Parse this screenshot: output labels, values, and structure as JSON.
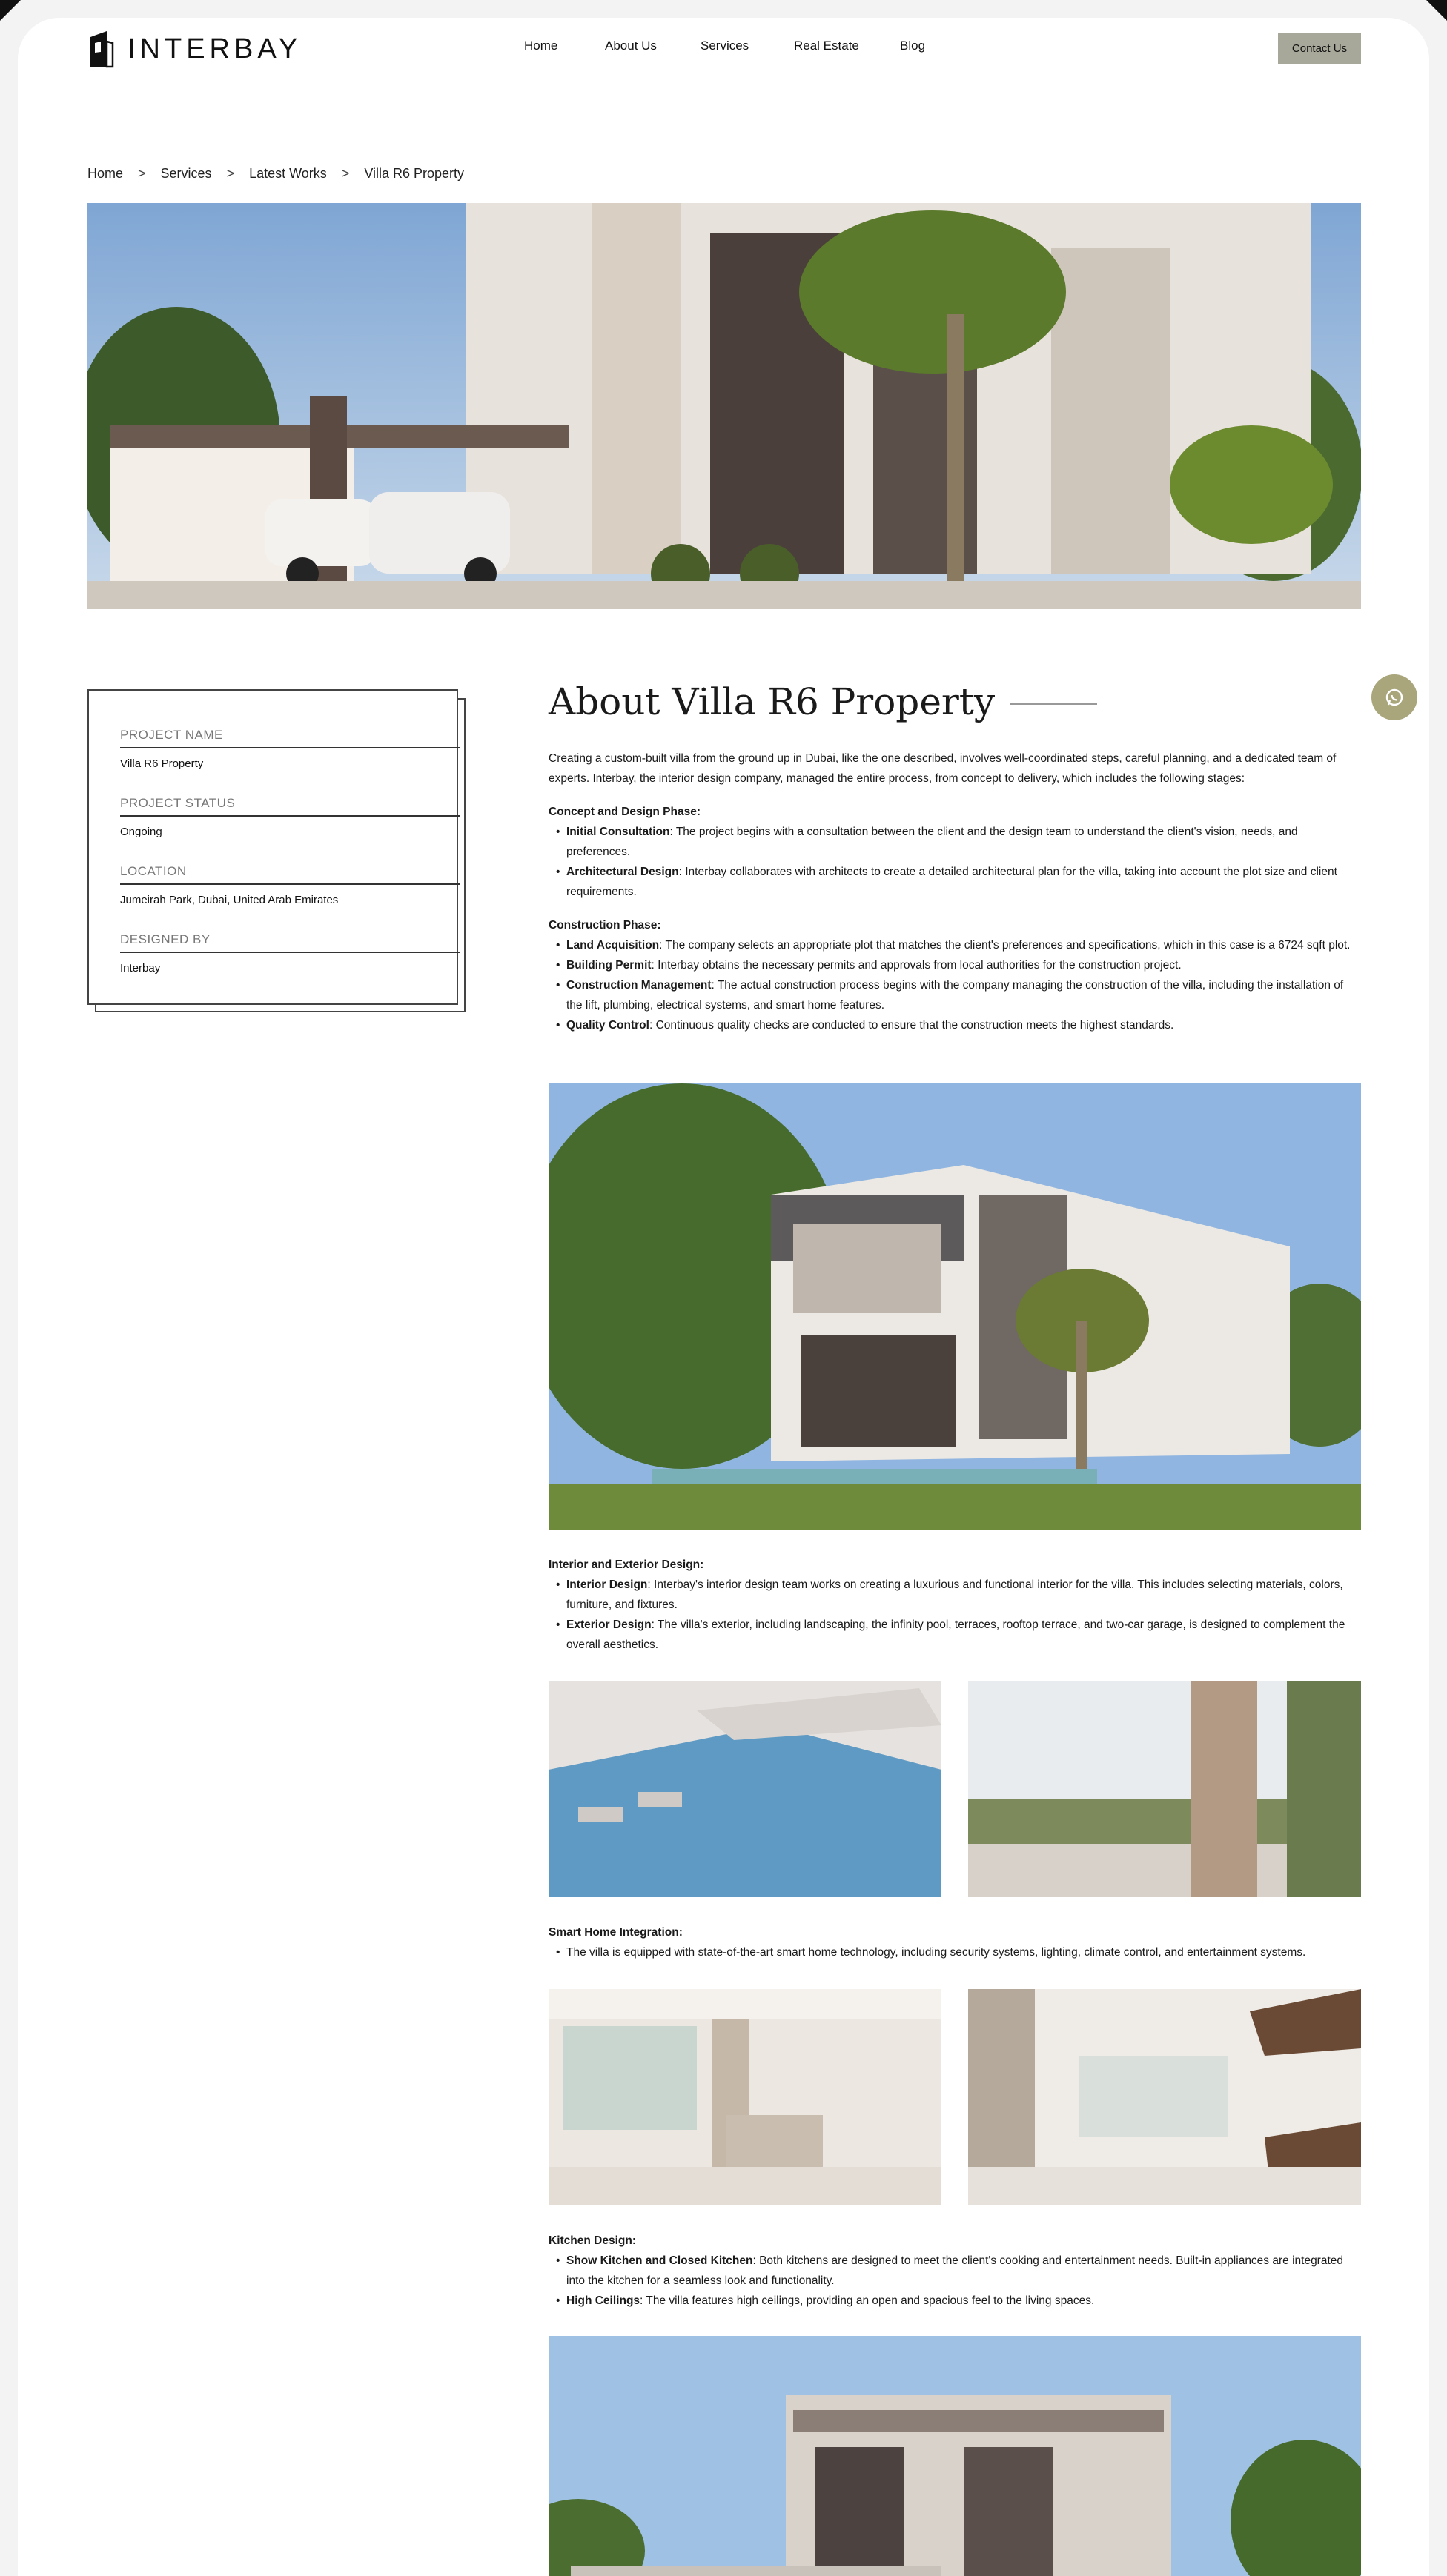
{
  "brand": {
    "name": "INTERBAY"
  },
  "nav": {
    "items": [
      "Home",
      "About Us",
      "Services",
      "Real Estate",
      "Blog"
    ],
    "contact": "Contact Us"
  },
  "breadcrumb": [
    "Home",
    "Services",
    "Latest Works",
    "Villa R6 Property"
  ],
  "breadcrumb_sep": ">",
  "project": {
    "name_label": "PROJECT NAME",
    "name": "Villa R6 Property",
    "status_label": "PROJECT STATUS",
    "status": "Ongoing",
    "location_label": "LOCATION",
    "location": "Jumeirah Park, Dubai, United Arab Emirates",
    "designer_label": "DESIGNED BY",
    "designer": "Interbay"
  },
  "about": {
    "title": "About Villa R6 Property",
    "intro": "Creating a custom-built villa from the ground up in Dubai, like the one described, involves well-coordinated steps, careful planning, and a dedicated team of experts. Interbay, the interior design company, managed the entire process, from concept to delivery, which includes the following stages:",
    "sections": [
      {
        "heading": "Concept and Design Phase",
        "items": [
          {
            "b": "Initial Consultation",
            "t": "The project begins with a consultation between the client and the design team to understand the client's vision, needs, and preferences."
          },
          {
            "b": "Architectural Design",
            "t": "Interbay collaborates with architects to create a detailed architectural plan for the villa, taking into account the plot size and client requirements."
          }
        ]
      },
      {
        "heading": "Construction Phase",
        "items": [
          {
            "b": "Land Acquisition",
            "t": "The company selects an appropriate plot that matches the client's preferences and specifications, which in this case is a 6724 sqft plot."
          },
          {
            "b": "Building Permit",
            "t": "Interbay obtains the necessary permits and approvals from local authorities for the construction project."
          },
          {
            "b": "Construction Management",
            "t": "The actual construction process begins with the company managing the construction of the villa, including the installation of the lift, plumbing, electrical systems, and smart home features."
          },
          {
            "b": "Quality Control",
            "t": "Continuous quality checks are conducted to ensure that the construction meets the highest standards."
          }
        ]
      },
      {
        "heading": "Interior and Exterior Design",
        "items": [
          {
            "b": "Interior Design",
            "t": "Interbay's interior design team works on creating a luxurious and functional interior for the villa. This includes selecting materials, colors, furniture, and fixtures."
          },
          {
            "b": "Exterior Design",
            "t": "The villa's exterior, including landscaping, the infinity pool, terraces, rooftop terrace, and two-car garage, is designed to complement the overall aesthetics."
          }
        ]
      },
      {
        "heading": "Smart Home Integration",
        "items": [
          {
            "b": "",
            "t": "The villa is equipped with state-of-the-art smart home technology, including security systems, lighting, climate control, and entertainment systems."
          }
        ]
      },
      {
        "heading": "Kitchen Design",
        "items": [
          {
            "b": "Show Kitchen and Closed Kitchen",
            "t": "Both kitchens are designed to meet the client's cooking and entertainment needs. Built-in appliances are integrated into the kitchen for a seamless look and functionality."
          },
          {
            "b": "High Ceilings",
            "t": "The villa features high ceilings, providing an open and spacious feel to the living spaces."
          }
        ]
      }
    ]
  },
  "colors": {
    "accent": "#a8a89a",
    "chat": "#a9a67b",
    "text": "#1a1a1a"
  },
  "icons": {
    "chat": "whatsapp-icon",
    "logo": "building-logo-icon"
  }
}
